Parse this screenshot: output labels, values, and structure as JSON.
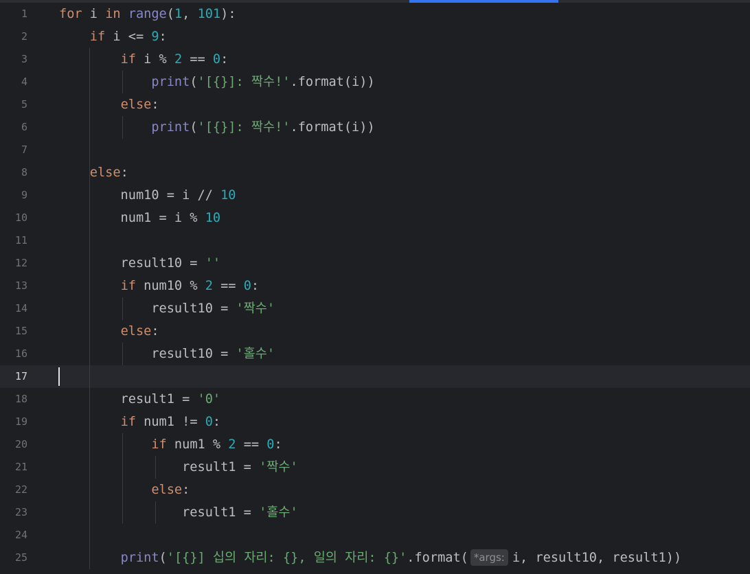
{
  "editor": {
    "current_line": "17",
    "lines": [
      {
        "n": "1",
        "t": [
          [
            "kw",
            "for"
          ],
          [
            "",
            null,
            " i "
          ],
          [
            "kw",
            "in"
          ],
          [
            "",
            " "
          ],
          [
            "bi",
            "range"
          ],
          [
            "",
            "("
          ],
          [
            "num",
            "1"
          ],
          [
            "",
            ", "
          ],
          [
            "num",
            "101"
          ],
          [
            "",
            "):"
          ]
        ]
      },
      {
        "n": "2",
        "t": [
          [
            "",
            "    "
          ],
          [
            "kw",
            "if"
          ],
          [
            "",
            " i <= "
          ],
          [
            "num",
            "9"
          ],
          [
            "",
            ":"
          ]
        ]
      },
      {
        "n": "3",
        "t": [
          [
            "",
            "        "
          ],
          [
            "kw",
            "if"
          ],
          [
            "",
            " i % "
          ],
          [
            "num",
            "2"
          ],
          [
            "",
            " == "
          ],
          [
            "num",
            "0"
          ],
          [
            "",
            ":"
          ]
        ]
      },
      {
        "n": "4",
        "t": [
          [
            "",
            "            "
          ],
          [
            "bi",
            "print"
          ],
          [
            "",
            "("
          ],
          [
            "str",
            "'[{}]: 짝수!'"
          ],
          [
            "",
            ".format(i))"
          ]
        ]
      },
      {
        "n": "5",
        "t": [
          [
            "",
            "        "
          ],
          [
            "kw",
            "else"
          ],
          [
            "",
            ":"
          ]
        ]
      },
      {
        "n": "6",
        "t": [
          [
            "",
            "            "
          ],
          [
            "bi",
            "print"
          ],
          [
            "",
            "("
          ],
          [
            "str",
            "'[{}]: 짝수!'"
          ],
          [
            "",
            ".format(i))"
          ]
        ]
      },
      {
        "n": "7",
        "t": []
      },
      {
        "n": "8",
        "t": [
          [
            "",
            "    "
          ],
          [
            "kw",
            "else"
          ],
          [
            "",
            ":"
          ]
        ]
      },
      {
        "n": "9",
        "t": [
          [
            "",
            "        num10 = i // "
          ],
          [
            "num",
            "10"
          ]
        ]
      },
      {
        "n": "10",
        "t": [
          [
            "",
            "        num1 = i % "
          ],
          [
            "num",
            "10"
          ]
        ]
      },
      {
        "n": "11",
        "t": []
      },
      {
        "n": "12",
        "t": [
          [
            "",
            "        result10 = "
          ],
          [
            "str",
            "''"
          ]
        ]
      },
      {
        "n": "13",
        "t": [
          [
            "",
            "        "
          ],
          [
            "kw",
            "if"
          ],
          [
            "",
            " num10 % "
          ],
          [
            "num",
            "2"
          ],
          [
            "",
            " == "
          ],
          [
            "num",
            "0"
          ],
          [
            "",
            ":"
          ]
        ]
      },
      {
        "n": "14",
        "t": [
          [
            "",
            "            result10 = "
          ],
          [
            "str",
            "'짝수'"
          ]
        ]
      },
      {
        "n": "15",
        "t": [
          [
            "",
            "        "
          ],
          [
            "kw",
            "else"
          ],
          [
            "",
            ":"
          ]
        ]
      },
      {
        "n": "16",
        "t": [
          [
            "",
            "            result10 = "
          ],
          [
            "str",
            "'홀수'"
          ]
        ]
      },
      {
        "n": "17",
        "t": []
      },
      {
        "n": "18",
        "t": [
          [
            "",
            "        result1 = "
          ],
          [
            "str",
            "'0'"
          ]
        ]
      },
      {
        "n": "19",
        "t": [
          [
            "",
            "        "
          ],
          [
            "kw",
            "if"
          ],
          [
            "",
            " num1 != "
          ],
          [
            "num",
            "0"
          ],
          [
            "",
            ":"
          ]
        ]
      },
      {
        "n": "20",
        "t": [
          [
            "",
            "            "
          ],
          [
            "kw",
            "if"
          ],
          [
            "",
            " num1 % "
          ],
          [
            "num",
            "2"
          ],
          [
            "",
            " == "
          ],
          [
            "num",
            "0"
          ],
          [
            "",
            ":"
          ]
        ]
      },
      {
        "n": "21",
        "t": [
          [
            "",
            "                result1 = "
          ],
          [
            "str",
            "'짝수'"
          ]
        ]
      },
      {
        "n": "22",
        "t": [
          [
            "",
            "            "
          ],
          [
            "kw",
            "else"
          ],
          [
            "",
            ":"
          ]
        ]
      },
      {
        "n": "23",
        "t": [
          [
            "",
            "                result1 = "
          ],
          [
            "str",
            "'홀수'"
          ]
        ]
      },
      {
        "n": "24",
        "t": []
      },
      {
        "n": "25",
        "t": [
          [
            "",
            "        "
          ],
          [
            "bi",
            "print"
          ],
          [
            "",
            "("
          ],
          [
            "str",
            "'[{}] 십의 자리: {}, 일의 자리: {}'"
          ],
          [
            "",
            ".format("
          ],
          [
            "hint",
            "*args:"
          ],
          [
            "",
            "i, result10, result1))"
          ]
        ]
      }
    ]
  },
  "colors": {
    "background": "#1e1f22",
    "current_line": "#26282e",
    "keyword": "#cf8e6d",
    "number": "#2aacb8",
    "string": "#6aab73",
    "builtin": "#8888c6",
    "text": "#bcbec4",
    "line_number": "#6f737a",
    "accent": "#3574f0"
  }
}
